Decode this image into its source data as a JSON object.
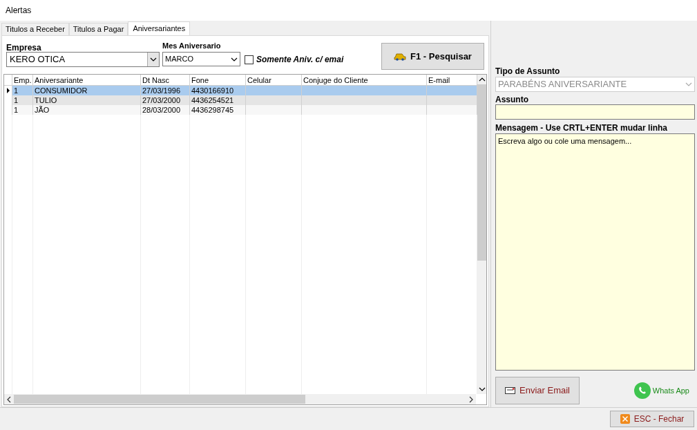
{
  "window": {
    "title": "Alertas"
  },
  "tabs": [
    {
      "label": "Titulos a Receber",
      "selected": false
    },
    {
      "label": "Titulos a Pagar",
      "selected": false
    },
    {
      "label": "Aniversariantes",
      "selected": true
    }
  ],
  "filters": {
    "empresa_label": "Empresa",
    "empresa_value": "KERO OTICA",
    "mes_label": "Mes Aniversario",
    "mes_value": "MARCO",
    "email_only": {
      "label": "Somente Aniv. c/ emai",
      "checked": false
    },
    "search_button": "F1 - Pesquisar"
  },
  "table": {
    "columns": [
      "Emp.",
      "Aniversariante",
      "Dt Nasc",
      "Fone",
      "Celular",
      "Conjuge do Cliente",
      "E-mail"
    ],
    "rows": [
      {
        "cells": [
          "1",
          "CONSUMIDOR",
          "27/03/1996",
          "4430166910",
          "",
          "",
          ""
        ],
        "selected": true
      },
      {
        "cells": [
          "1",
          "TULIO",
          "27/03/2000",
          "4436254521",
          "",
          "",
          ""
        ],
        "selected": false
      },
      {
        "cells": [
          "1",
          "JÃO",
          "28/03/2000",
          "4436298745",
          "",
          "",
          ""
        ],
        "selected": false
      }
    ]
  },
  "message_panel": {
    "tipo_label": "Tipo de Assunto",
    "tipo_value": "PARABÉNS ANIVERSARIANTE",
    "tipo_disabled": true,
    "assunto_label": "Assunto",
    "mensagem_label": "Mensagem - Use CRTL+ENTER mudar linha",
    "mensagem_value": "Escreva algo ou cole uma mensagem...",
    "email_button": "Enviar Email",
    "whatsapp_button": "Whats App"
  },
  "close_button": "ESC - Fechar"
}
